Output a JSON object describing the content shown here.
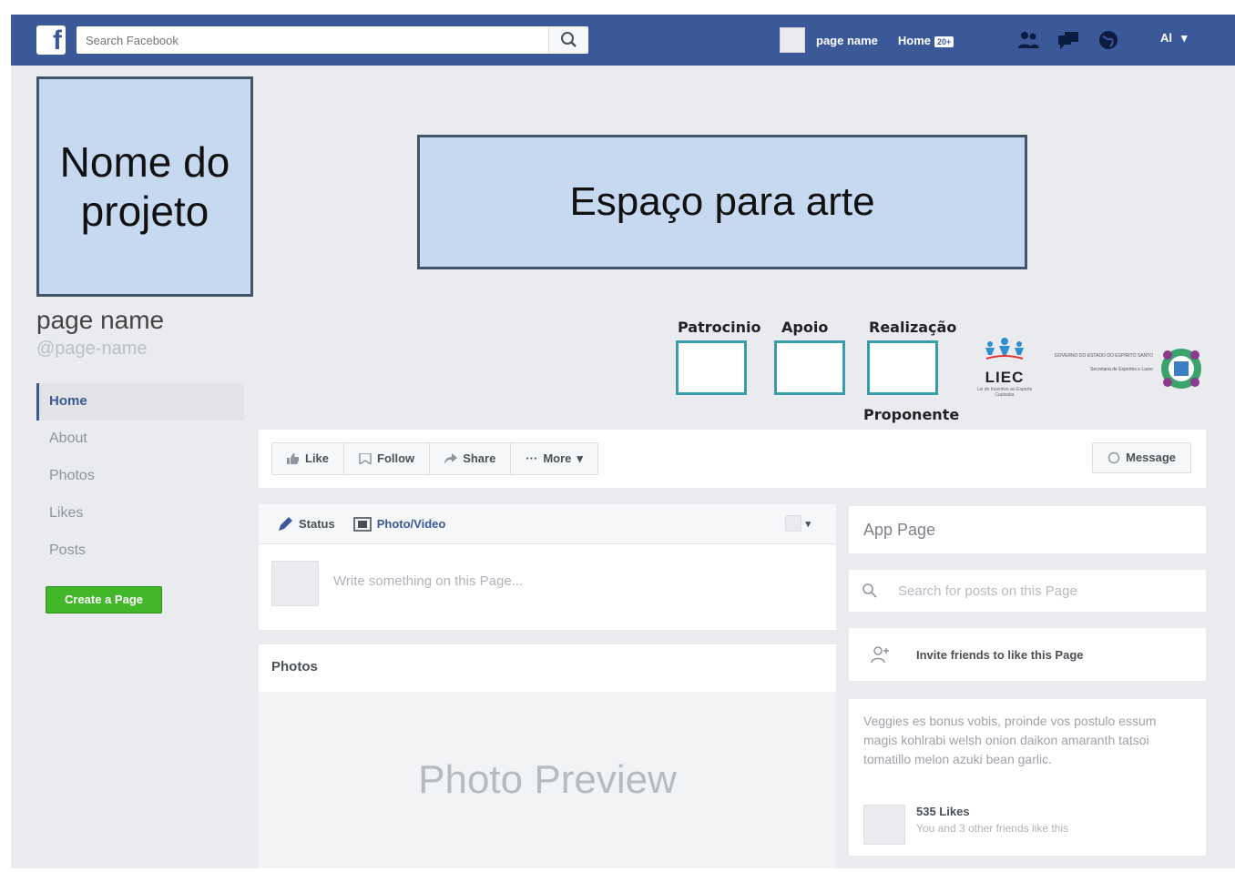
{
  "topbar": {
    "logo": "f",
    "search_placeholder": "Search Facebook",
    "page_name": "page name",
    "home_label": "Home",
    "home_count": "20+",
    "account_label": "Al"
  },
  "profile": {
    "project_name": "Nome do projeto",
    "page_name": "page name",
    "handle": "@page-name"
  },
  "left_nav": {
    "items": [
      "Home",
      "About",
      "Photos",
      "Likes",
      "Posts"
    ],
    "create_page": "Create a Page"
  },
  "cover": {
    "art_label": "Espaço para arte"
  },
  "sponsors": {
    "patrocinio": "Patrocinio",
    "apoio": "Apoio",
    "realizacao": "Realização",
    "proponente": "Proponente"
  },
  "logos": {
    "liec_name": "LIEC",
    "liec_sub": "Lei de Incentivo ao Esporte Capixaba",
    "gov_top": "GOVERNO DO ESTADO DO ESPÍRITO SANTO",
    "gov_sub": "Secretaria de Esportes e Lazer"
  },
  "actions": {
    "like": "Like",
    "follow": "Follow",
    "share": "Share",
    "more": "More",
    "message": "Message"
  },
  "composer": {
    "status": "Status",
    "photo_video": "Photo/Video",
    "placeholder": "Write something on this Page..."
  },
  "photos": {
    "title": "Photos",
    "preview": "Photo Preview"
  },
  "right": {
    "app_page": "App Page",
    "search_posts": "Search for posts on this Page",
    "invite": "Invite friends to like this Page",
    "about": "Veggies es bonus vobis, proinde vos postulo essum magis kohlrabi welsh onion daikon amaranth tatsoi tomatillo melon azuki bean garlic.",
    "likes_count": "535 Likes",
    "likes_sub": "You and 3 other friends like this"
  },
  "colors": {
    "brand": "#3b5998",
    "placeholder_fill": "#c6d9f1",
    "sponsor_box_border": "#3b9cab",
    "create_page": "#42b72a"
  }
}
